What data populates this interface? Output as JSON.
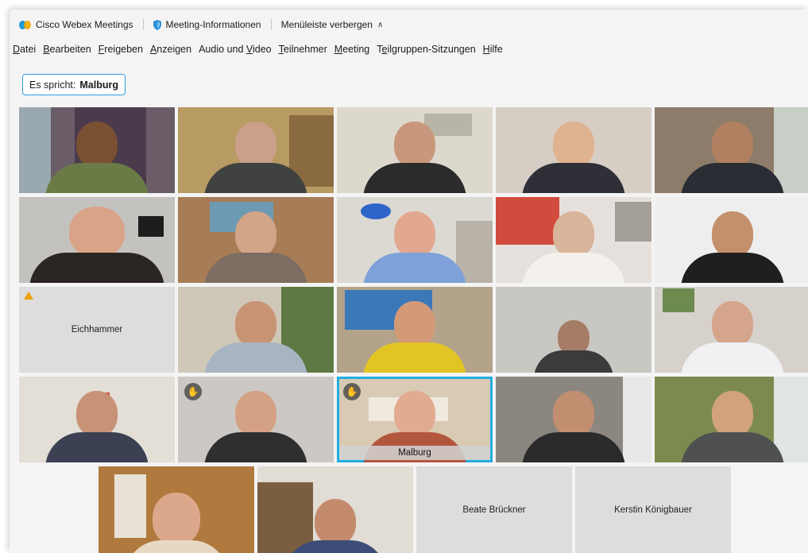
{
  "titlebar": {
    "app_name": "Cisco Webex Meetings",
    "meeting_info": "Meeting-Informationen",
    "hide_menu": "Menüleiste verbergen"
  },
  "menu": [
    {
      "prefix": "",
      "key": "D",
      "rest": "atei"
    },
    {
      "prefix": "",
      "key": "B",
      "rest": "earbeiten"
    },
    {
      "prefix": "",
      "key": "F",
      "rest": "reigeben"
    },
    {
      "prefix": "",
      "key": "A",
      "rest": "nzeigen"
    },
    {
      "prefix": "Audio und ",
      "key": "V",
      "rest": "ideo"
    },
    {
      "prefix": "",
      "key": "T",
      "rest": "eilnehmer"
    },
    {
      "prefix": "",
      "key": "M",
      "rest": "eeting"
    },
    {
      "prefix": "T",
      "key": "e",
      "rest": "ilgruppen-Sitzungen"
    },
    {
      "prefix": "",
      "key": "H",
      "rest": "ilfe"
    }
  ],
  "speaker": {
    "label": "Es spricht:",
    "name": "Malburg"
  },
  "participants": {
    "eichhammer": "Eichhammer",
    "malburg": "Malburg",
    "brueckner": "Beate Brückner",
    "koenigbauer": "Kerstin Königbauer"
  },
  "colors": {
    "accent": "#22aee0",
    "warning": "#f0a000"
  }
}
